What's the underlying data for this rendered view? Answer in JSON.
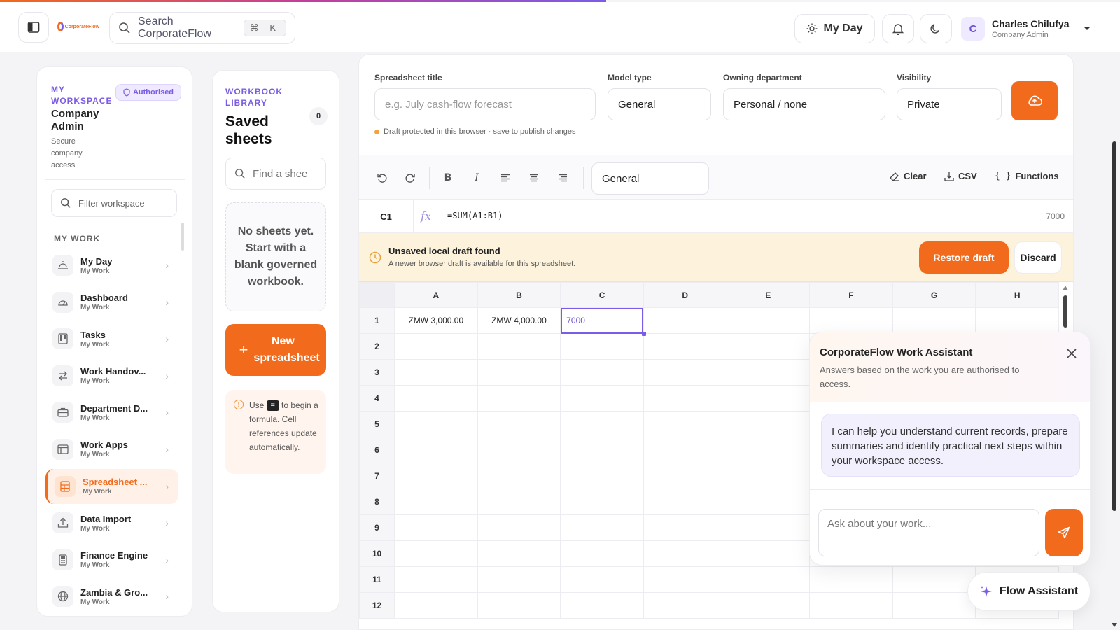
{
  "app": {
    "logo_text": "CorporateFlow",
    "search_placeholder": "Search CorporateFlow",
    "search_shortcut": "⌘ K",
    "myday_label": "My Day",
    "user": {
      "initial": "C",
      "name": "Charles Chilufya",
      "role": "Company Admin"
    }
  },
  "sidebar": {
    "workspace_label": "MY WORKSPACE",
    "authorised_badge": "Authorised",
    "title": "Company Admin",
    "subtitle": "Secure company access",
    "filter_placeholder": "Filter workspace",
    "section_label": "MY WORK",
    "items": [
      {
        "label": "My Day",
        "sub": "My Work"
      },
      {
        "label": "Dashboard",
        "sub": "My Work"
      },
      {
        "label": "Tasks",
        "sub": "My Work"
      },
      {
        "label": "Work Handov...",
        "sub": "My Work"
      },
      {
        "label": "Department D...",
        "sub": "My Work"
      },
      {
        "label": "Work Apps",
        "sub": "My Work"
      },
      {
        "label": "Spreadsheet ...",
        "sub": "My Work"
      },
      {
        "label": "Data Import",
        "sub": "My Work"
      },
      {
        "label": "Finance Engine",
        "sub": "My Work"
      },
      {
        "label": "Zambia & Gro...",
        "sub": "My Work"
      }
    ]
  },
  "library": {
    "label": "WORKBOOK LIBRARY",
    "title": "Saved sheets",
    "count": "0",
    "search_placeholder": "Find a shee",
    "empty_text": "No sheets yet. Start with a blank governed workbook.",
    "new_button": "New spreadsheet",
    "tip_prefix": "Use",
    "tip_key": "=",
    "tip_suffix": "to begin a formula. Cell references update automatically."
  },
  "form": {
    "title_label": "Spreadsheet title",
    "title_placeholder": "e.g. July cash-flow forecast",
    "model_label": "Model type",
    "model_value": "General",
    "dept_label": "Owning department",
    "dept_value": "Personal / none",
    "visibility_label": "Visibility",
    "visibility_value": "Private",
    "draft_note": "Draft protected in this browser · save to publish changes"
  },
  "toolbar": {
    "format_value": "General",
    "clear_label": "Clear",
    "csv_label": "CSV",
    "functions_label": "Functions"
  },
  "formula_bar": {
    "cell": "C1",
    "fx": "fx",
    "formula": "=SUM(A1:B1)",
    "result": "7000"
  },
  "banner": {
    "title": "Unsaved local draft found",
    "subtitle": "A newer browser draft is available for this spreadsheet.",
    "restore_label": "Restore draft",
    "discard_label": "Discard"
  },
  "grid": {
    "columns": [
      "A",
      "B",
      "C",
      "D",
      "E",
      "F",
      "G",
      "H"
    ],
    "rows": [
      [
        "ZMW 3,000.00",
        "ZMW 4,000.00",
        "7000",
        "",
        "",
        "",
        "",
        ""
      ],
      [
        "",
        "",
        "",
        "",
        "",
        "",
        "",
        ""
      ],
      [
        "",
        "",
        "",
        "",
        "",
        "",
        "",
        ""
      ],
      [
        "",
        "",
        "",
        "",
        "",
        "",
        "",
        ""
      ],
      [
        "",
        "",
        "",
        "",
        "",
        "",
        "",
        ""
      ],
      [
        "",
        "",
        "",
        "",
        "",
        "",
        "",
        ""
      ],
      [
        "",
        "",
        "",
        "",
        "",
        "",
        "",
        ""
      ],
      [
        "",
        "",
        "",
        "",
        "",
        "",
        "",
        ""
      ],
      [
        "",
        "",
        "",
        "",
        "",
        "",
        "",
        ""
      ],
      [
        "",
        "",
        "",
        "",
        "",
        "",
        "",
        ""
      ],
      [
        "",
        "",
        "",
        "",
        "",
        "",
        "",
        ""
      ],
      [
        "",
        "",
        "",
        "",
        "",
        "",
        "",
        ""
      ]
    ],
    "row_numbers": [
      "1",
      "2",
      "3",
      "4",
      "5",
      "6",
      "7",
      "8",
      "9",
      "10",
      "11",
      "12"
    ]
  },
  "assistant": {
    "title": "CorporateFlow Work Assistant",
    "subtitle": "Answers based on the work you are authorised to access.",
    "message": "I can help you understand current records, prepare summaries and identify practical next steps within your workspace access.",
    "input_placeholder": "Ask about your work...",
    "flow_button": "Flow Assistant"
  },
  "colors": {
    "accent": "#f26a1b",
    "brand_purple": "#7b5ce6",
    "banner_bg": "#fdf3dc"
  }
}
